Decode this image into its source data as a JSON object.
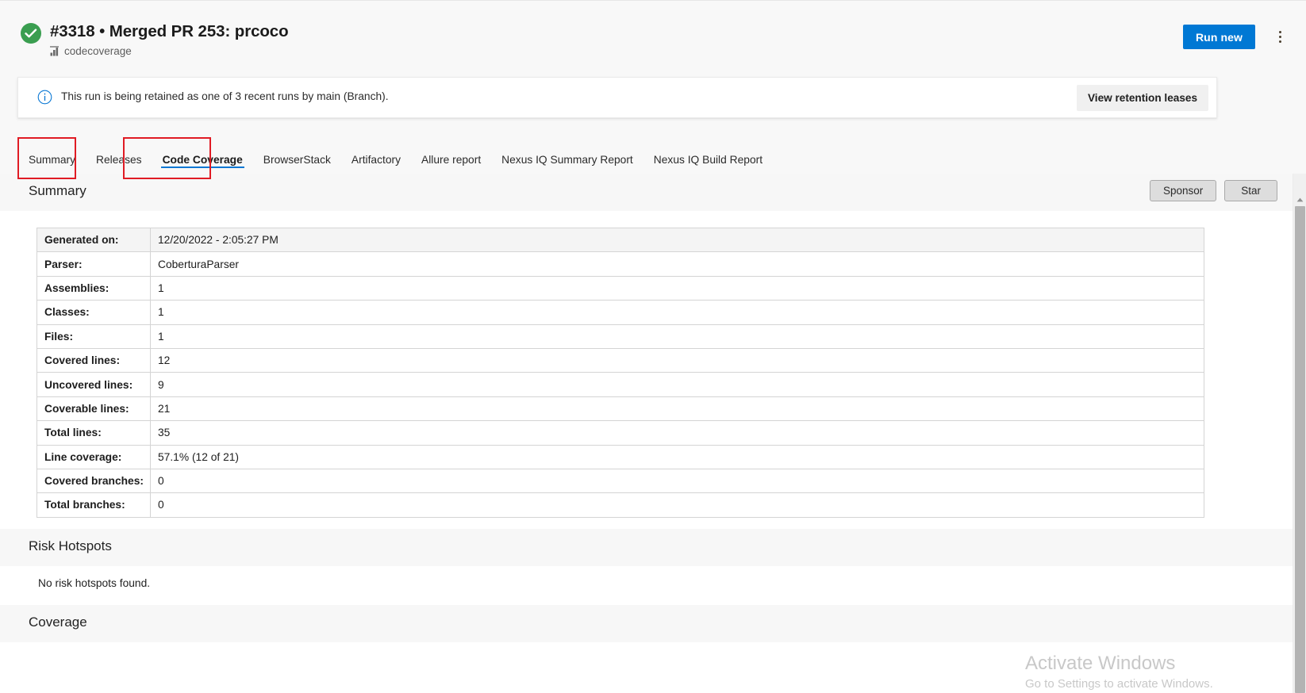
{
  "header": {
    "status_icon": "check-circle-icon",
    "status_color": "#3a9e50",
    "title": "#3318 • Merged PR 253: prcoco",
    "pipeline_icon": "pipeline-icon",
    "pipeline_name": "codecoverage",
    "run_new_label": "Run new",
    "run_new_color": "#0078d4",
    "more_actions_icon": "kebab-menu-icon"
  },
  "banner": {
    "info_icon": "info-circle-icon",
    "message": "This run is being retained as one of 3 recent runs by main (Branch).",
    "action_label": "View retention leases"
  },
  "tabs": {
    "items": [
      {
        "label": "Summary",
        "active": false
      },
      {
        "label": "Releases",
        "active": false
      },
      {
        "label": "Code Coverage",
        "active": true
      },
      {
        "label": "BrowserStack",
        "active": false
      },
      {
        "label": "Artifactory",
        "active": false
      },
      {
        "label": "Allure report",
        "active": false
      },
      {
        "label": "Nexus IQ Summary Report",
        "active": false
      },
      {
        "label": "Nexus IQ Build Report",
        "active": false
      }
    ],
    "active_underline_color": "#0a78d4",
    "annotation_color": "#e01b24"
  },
  "summary_section": {
    "title": "Summary",
    "sponsor_label": "Sponsor",
    "star_label": "Star",
    "rows": [
      {
        "key": "Generated on:",
        "value": "12/20/2022 - 2:05:27 PM",
        "shaded": true
      },
      {
        "key": "Parser:",
        "value": "CoberturaParser",
        "shaded": false
      },
      {
        "key": "Assemblies:",
        "value": "1",
        "shaded": false
      },
      {
        "key": "Classes:",
        "value": "1",
        "shaded": false
      },
      {
        "key": "Files:",
        "value": "1",
        "shaded": false
      },
      {
        "key": "Covered lines:",
        "value": "12",
        "shaded": false
      },
      {
        "key": "Uncovered lines:",
        "value": "9",
        "shaded": false
      },
      {
        "key": "Coverable lines:",
        "value": "21",
        "shaded": false
      },
      {
        "key": "Total lines:",
        "value": "35",
        "shaded": false
      },
      {
        "key": "Line coverage:",
        "value": "57.1% (12 of 21)",
        "shaded": false
      },
      {
        "key": "Covered branches:",
        "value": "0",
        "shaded": false
      },
      {
        "key": "Total branches:",
        "value": "0",
        "shaded": false
      }
    ]
  },
  "risk_hotspots_section": {
    "title": "Risk Hotspots",
    "empty_message": "No risk hotspots found."
  },
  "coverage_section": {
    "title": "Coverage"
  },
  "watermark": {
    "title": "Activate Windows",
    "subtitle": "Go to Settings to activate Windows."
  },
  "scrollbar": {
    "up_arrow_icon": "scroll-up-arrow-icon"
  }
}
